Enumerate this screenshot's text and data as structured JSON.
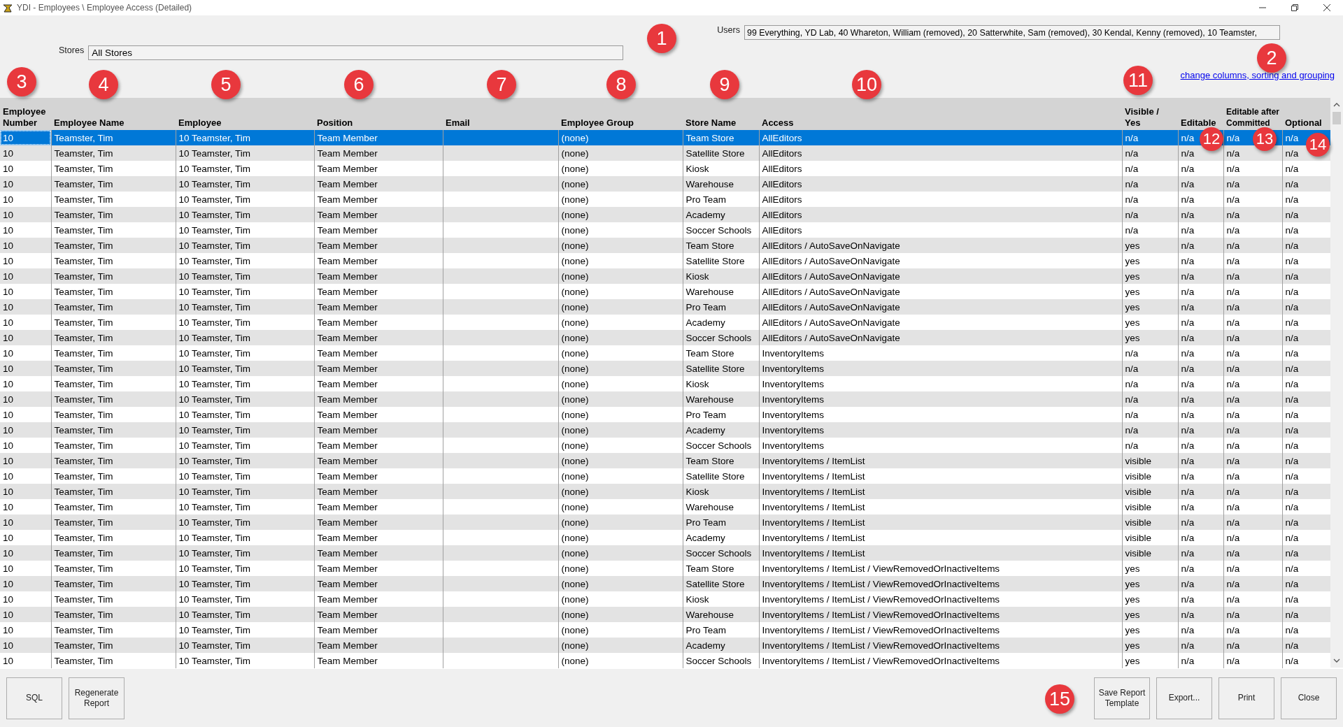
{
  "window": {
    "title": "YDI - Employees \\ Employee Access (Detailed)"
  },
  "filters": {
    "users_label": "Users",
    "users_value": "99 Everything, YD Lab, 40 Whareton, William (removed), 20 Satterwhite, Sam (removed), 30 Kendal, Kenny (removed), 10 Teamster,",
    "stores_label": "Stores",
    "stores_value": "All Stores"
  },
  "link": "change columns, sorting and grouping",
  "callouts": [
    "1",
    "2",
    "3",
    "4",
    "5",
    "6",
    "7",
    "8",
    "9",
    "10",
    "11",
    "12",
    "13",
    "14",
    "15"
  ],
  "table": {
    "columns": [
      "Employee\nNumber",
      "Employee Name",
      "Employee",
      "Position",
      "Email",
      "Employee Group",
      "Store Name",
      "Access",
      "Visible /\nYes",
      "Editable",
      "Editable after\nCommitted",
      "Optional"
    ],
    "rows": [
      {
        "selected": true,
        "cells": [
          "10",
          "Teamster, Tim",
          "10 Teamster, Tim",
          "Team Member",
          "",
          "(none)",
          "Team Store",
          "AllEditors",
          "n/a",
          "n/a",
          "n/a",
          "n/a"
        ]
      },
      {
        "selected": false,
        "cells": [
          "10",
          "Teamster, Tim",
          "10 Teamster, Tim",
          "Team Member",
          "",
          "(none)",
          "Satellite Store",
          "AllEditors",
          "n/a",
          "n/a",
          "n/a",
          "n/a"
        ]
      },
      {
        "selected": false,
        "cells": [
          "10",
          "Teamster, Tim",
          "10 Teamster, Tim",
          "Team Member",
          "",
          "(none)",
          "Kiosk",
          "AllEditors",
          "n/a",
          "n/a",
          "n/a",
          "n/a"
        ]
      },
      {
        "selected": false,
        "cells": [
          "10",
          "Teamster, Tim",
          "10 Teamster, Tim",
          "Team Member",
          "",
          "(none)",
          "Warehouse",
          "AllEditors",
          "n/a",
          "n/a",
          "n/a",
          "n/a"
        ]
      },
      {
        "selected": false,
        "cells": [
          "10",
          "Teamster, Tim",
          "10 Teamster, Tim",
          "Team Member",
          "",
          "(none)",
          "Pro Team",
          "AllEditors",
          "n/a",
          "n/a",
          "n/a",
          "n/a"
        ]
      },
      {
        "selected": false,
        "cells": [
          "10",
          "Teamster, Tim",
          "10 Teamster, Tim",
          "Team Member",
          "",
          "(none)",
          "Academy",
          "AllEditors",
          "n/a",
          "n/a",
          "n/a",
          "n/a"
        ]
      },
      {
        "selected": false,
        "cells": [
          "10",
          "Teamster, Tim",
          "10 Teamster, Tim",
          "Team Member",
          "",
          "(none)",
          "Soccer Schools",
          "AllEditors",
          "n/a",
          "n/a",
          "n/a",
          "n/a"
        ]
      },
      {
        "selected": false,
        "cells": [
          "10",
          "Teamster, Tim",
          "10 Teamster, Tim",
          "Team Member",
          "",
          "(none)",
          "Team Store",
          "AllEditors / AutoSaveOnNavigate",
          "yes",
          "n/a",
          "n/a",
          "n/a"
        ]
      },
      {
        "selected": false,
        "cells": [
          "10",
          "Teamster, Tim",
          "10 Teamster, Tim",
          "Team Member",
          "",
          "(none)",
          "Satellite Store",
          "AllEditors / AutoSaveOnNavigate",
          "yes",
          "n/a",
          "n/a",
          "n/a"
        ]
      },
      {
        "selected": false,
        "cells": [
          "10",
          "Teamster, Tim",
          "10 Teamster, Tim",
          "Team Member",
          "",
          "(none)",
          "Kiosk",
          "AllEditors / AutoSaveOnNavigate",
          "yes",
          "n/a",
          "n/a",
          "n/a"
        ]
      },
      {
        "selected": false,
        "cells": [
          "10",
          "Teamster, Tim",
          "10 Teamster, Tim",
          "Team Member",
          "",
          "(none)",
          "Warehouse",
          "AllEditors / AutoSaveOnNavigate",
          "yes",
          "n/a",
          "n/a",
          "n/a"
        ]
      },
      {
        "selected": false,
        "cells": [
          "10",
          "Teamster, Tim",
          "10 Teamster, Tim",
          "Team Member",
          "",
          "(none)",
          "Pro Team",
          "AllEditors / AutoSaveOnNavigate",
          "yes",
          "n/a",
          "n/a",
          "n/a"
        ]
      },
      {
        "selected": false,
        "cells": [
          "10",
          "Teamster, Tim",
          "10 Teamster, Tim",
          "Team Member",
          "",
          "(none)",
          "Academy",
          "AllEditors / AutoSaveOnNavigate",
          "yes",
          "n/a",
          "n/a",
          "n/a"
        ]
      },
      {
        "selected": false,
        "cells": [
          "10",
          "Teamster, Tim",
          "10 Teamster, Tim",
          "Team Member",
          "",
          "(none)",
          "Soccer Schools",
          "AllEditors / AutoSaveOnNavigate",
          "yes",
          "n/a",
          "n/a",
          "n/a"
        ]
      },
      {
        "selected": false,
        "cells": [
          "10",
          "Teamster, Tim",
          "10 Teamster, Tim",
          "Team Member",
          "",
          "(none)",
          "Team Store",
          "InventoryItems",
          "n/a",
          "n/a",
          "n/a",
          "n/a"
        ]
      },
      {
        "selected": false,
        "cells": [
          "10",
          "Teamster, Tim",
          "10 Teamster, Tim",
          "Team Member",
          "",
          "(none)",
          "Satellite Store",
          "InventoryItems",
          "n/a",
          "n/a",
          "n/a",
          "n/a"
        ]
      },
      {
        "selected": false,
        "cells": [
          "10",
          "Teamster, Tim",
          "10 Teamster, Tim",
          "Team Member",
          "",
          "(none)",
          "Kiosk",
          "InventoryItems",
          "n/a",
          "n/a",
          "n/a",
          "n/a"
        ]
      },
      {
        "selected": false,
        "cells": [
          "10",
          "Teamster, Tim",
          "10 Teamster, Tim",
          "Team Member",
          "",
          "(none)",
          "Warehouse",
          "InventoryItems",
          "n/a",
          "n/a",
          "n/a",
          "n/a"
        ]
      },
      {
        "selected": false,
        "cells": [
          "10",
          "Teamster, Tim",
          "10 Teamster, Tim",
          "Team Member",
          "",
          "(none)",
          "Pro Team",
          "InventoryItems",
          "n/a",
          "n/a",
          "n/a",
          "n/a"
        ]
      },
      {
        "selected": false,
        "cells": [
          "10",
          "Teamster, Tim",
          "10 Teamster, Tim",
          "Team Member",
          "",
          "(none)",
          "Academy",
          "InventoryItems",
          "n/a",
          "n/a",
          "n/a",
          "n/a"
        ]
      },
      {
        "selected": false,
        "cells": [
          "10",
          "Teamster, Tim",
          "10 Teamster, Tim",
          "Team Member",
          "",
          "(none)",
          "Soccer Schools",
          "InventoryItems",
          "n/a",
          "n/a",
          "n/a",
          "n/a"
        ]
      },
      {
        "selected": false,
        "cells": [
          "10",
          "Teamster, Tim",
          "10 Teamster, Tim",
          "Team Member",
          "",
          "(none)",
          "Team Store",
          "InventoryItems / ItemList",
          "visible",
          "n/a",
          "n/a",
          "n/a"
        ]
      },
      {
        "selected": false,
        "cells": [
          "10",
          "Teamster, Tim",
          "10 Teamster, Tim",
          "Team Member",
          "",
          "(none)",
          "Satellite Store",
          "InventoryItems / ItemList",
          "visible",
          "n/a",
          "n/a",
          "n/a"
        ]
      },
      {
        "selected": false,
        "cells": [
          "10",
          "Teamster, Tim",
          "10 Teamster, Tim",
          "Team Member",
          "",
          "(none)",
          "Kiosk",
          "InventoryItems / ItemList",
          "visible",
          "n/a",
          "n/a",
          "n/a"
        ]
      },
      {
        "selected": false,
        "cells": [
          "10",
          "Teamster, Tim",
          "10 Teamster, Tim",
          "Team Member",
          "",
          "(none)",
          "Warehouse",
          "InventoryItems / ItemList",
          "visible",
          "n/a",
          "n/a",
          "n/a"
        ]
      },
      {
        "selected": false,
        "cells": [
          "10",
          "Teamster, Tim",
          "10 Teamster, Tim",
          "Team Member",
          "",
          "(none)",
          "Pro Team",
          "InventoryItems / ItemList",
          "visible",
          "n/a",
          "n/a",
          "n/a"
        ]
      },
      {
        "selected": false,
        "cells": [
          "10",
          "Teamster, Tim",
          "10 Teamster, Tim",
          "Team Member",
          "",
          "(none)",
          "Academy",
          "InventoryItems / ItemList",
          "visible",
          "n/a",
          "n/a",
          "n/a"
        ]
      },
      {
        "selected": false,
        "cells": [
          "10",
          "Teamster, Tim",
          "10 Teamster, Tim",
          "Team Member",
          "",
          "(none)",
          "Soccer Schools",
          "InventoryItems / ItemList",
          "visible",
          "n/a",
          "n/a",
          "n/a"
        ]
      },
      {
        "selected": false,
        "cells": [
          "10",
          "Teamster, Tim",
          "10 Teamster, Tim",
          "Team Member",
          "",
          "(none)",
          "Team Store",
          "InventoryItems / ItemList / ViewRemovedOrInactiveItems",
          "yes",
          "n/a",
          "n/a",
          "n/a"
        ]
      },
      {
        "selected": false,
        "cells": [
          "10",
          "Teamster, Tim",
          "10 Teamster, Tim",
          "Team Member",
          "",
          "(none)",
          "Satellite Store",
          "InventoryItems / ItemList / ViewRemovedOrInactiveItems",
          "yes",
          "n/a",
          "n/a",
          "n/a"
        ]
      },
      {
        "selected": false,
        "cells": [
          "10",
          "Teamster, Tim",
          "10 Teamster, Tim",
          "Team Member",
          "",
          "(none)",
          "Kiosk",
          "InventoryItems / ItemList / ViewRemovedOrInactiveItems",
          "yes",
          "n/a",
          "n/a",
          "n/a"
        ]
      },
      {
        "selected": false,
        "cells": [
          "10",
          "Teamster, Tim",
          "10 Teamster, Tim",
          "Team Member",
          "",
          "(none)",
          "Warehouse",
          "InventoryItems / ItemList / ViewRemovedOrInactiveItems",
          "yes",
          "n/a",
          "n/a",
          "n/a"
        ]
      },
      {
        "selected": false,
        "cells": [
          "10",
          "Teamster, Tim",
          "10 Teamster, Tim",
          "Team Member",
          "",
          "(none)",
          "Pro Team",
          "InventoryItems / ItemList / ViewRemovedOrInactiveItems",
          "yes",
          "n/a",
          "n/a",
          "n/a"
        ]
      },
      {
        "selected": false,
        "cells": [
          "10",
          "Teamster, Tim",
          "10 Teamster, Tim",
          "Team Member",
          "",
          "(none)",
          "Academy",
          "InventoryItems / ItemList / ViewRemovedOrInactiveItems",
          "yes",
          "n/a",
          "n/a",
          "n/a"
        ]
      },
      {
        "selected": false,
        "cells": [
          "10",
          "Teamster, Tim",
          "10 Teamster, Tim",
          "Team Member",
          "",
          "(none)",
          "Soccer Schools",
          "InventoryItems / ItemList / ViewRemovedOrInactiveItems",
          "yes",
          "n/a",
          "n/a",
          "n/a"
        ]
      }
    ]
  },
  "buttons_left": [
    "SQL",
    "Regenerate Report"
  ],
  "buttons_right": [
    "Save Report Template",
    "Export...",
    "Print",
    "Close"
  ]
}
